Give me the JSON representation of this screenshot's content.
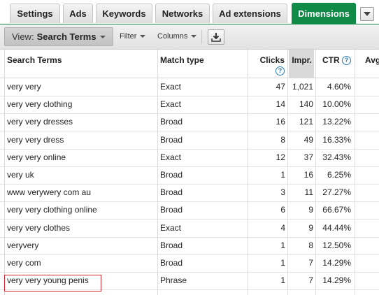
{
  "tabs": [
    {
      "label": "Settings",
      "active": false
    },
    {
      "label": "Ads",
      "active": false
    },
    {
      "label": "Keywords",
      "active": false
    },
    {
      "label": "Networks",
      "active": false
    },
    {
      "label": "Ad extensions",
      "active": false
    },
    {
      "label": "Dimensions",
      "active": true
    }
  ],
  "toolbar": {
    "view_label": "View:",
    "view_value": "Search Terms",
    "filter_label": "Filter",
    "columns_label": "Columns"
  },
  "table": {
    "headers": {
      "search_terms": "Search Terms",
      "match_type": "Match type",
      "clicks": "Clicks",
      "impr": "Impr.",
      "ctr": "CTR",
      "avg": "Avg"
    },
    "help_glyph": "?",
    "rows": [
      {
        "term": "very very",
        "match": "Exact",
        "clicks": "47",
        "impr": "1,021",
        "ctr": "4.60%"
      },
      {
        "term": "very very clothing",
        "match": "Exact",
        "clicks": "14",
        "impr": "140",
        "ctr": "10.00%"
      },
      {
        "term": "very very dresses",
        "match": "Broad",
        "clicks": "16",
        "impr": "121",
        "ctr": "13.22%"
      },
      {
        "term": "very very dress",
        "match": "Broad",
        "clicks": "8",
        "impr": "49",
        "ctr": "16.33%"
      },
      {
        "term": "very very online",
        "match": "Exact",
        "clicks": "12",
        "impr": "37",
        "ctr": "32.43%"
      },
      {
        "term": "very uk",
        "match": "Broad",
        "clicks": "1",
        "impr": "16",
        "ctr": "6.25%"
      },
      {
        "term": "www verywery com au",
        "match": "Broad",
        "clicks": "3",
        "impr": "11",
        "ctr": "27.27%"
      },
      {
        "term": "very very clothing online",
        "match": "Broad",
        "clicks": "6",
        "impr": "9",
        "ctr": "66.67%"
      },
      {
        "term": "very very clothes",
        "match": "Exact",
        "clicks": "4",
        "impr": "9",
        "ctr": "44.44%"
      },
      {
        "term": "veryvery",
        "match": "Broad",
        "clicks": "1",
        "impr": "8",
        "ctr": "12.50%"
      },
      {
        "term": "very com",
        "match": "Broad",
        "clicks": "1",
        "impr": "7",
        "ctr": "14.29%"
      },
      {
        "term": "very very young penis",
        "match": "Phrase",
        "clicks": "1",
        "impr": "7",
        "ctr": "14.29%"
      }
    ]
  },
  "colors": {
    "active_tab": "#0f8a47",
    "highlight_border": "#d0282c",
    "help_icon": "#2a7ab0"
  },
  "icons": {
    "tab_more": "chevron-down-icon",
    "download": "download-icon",
    "help": "help-icon"
  }
}
